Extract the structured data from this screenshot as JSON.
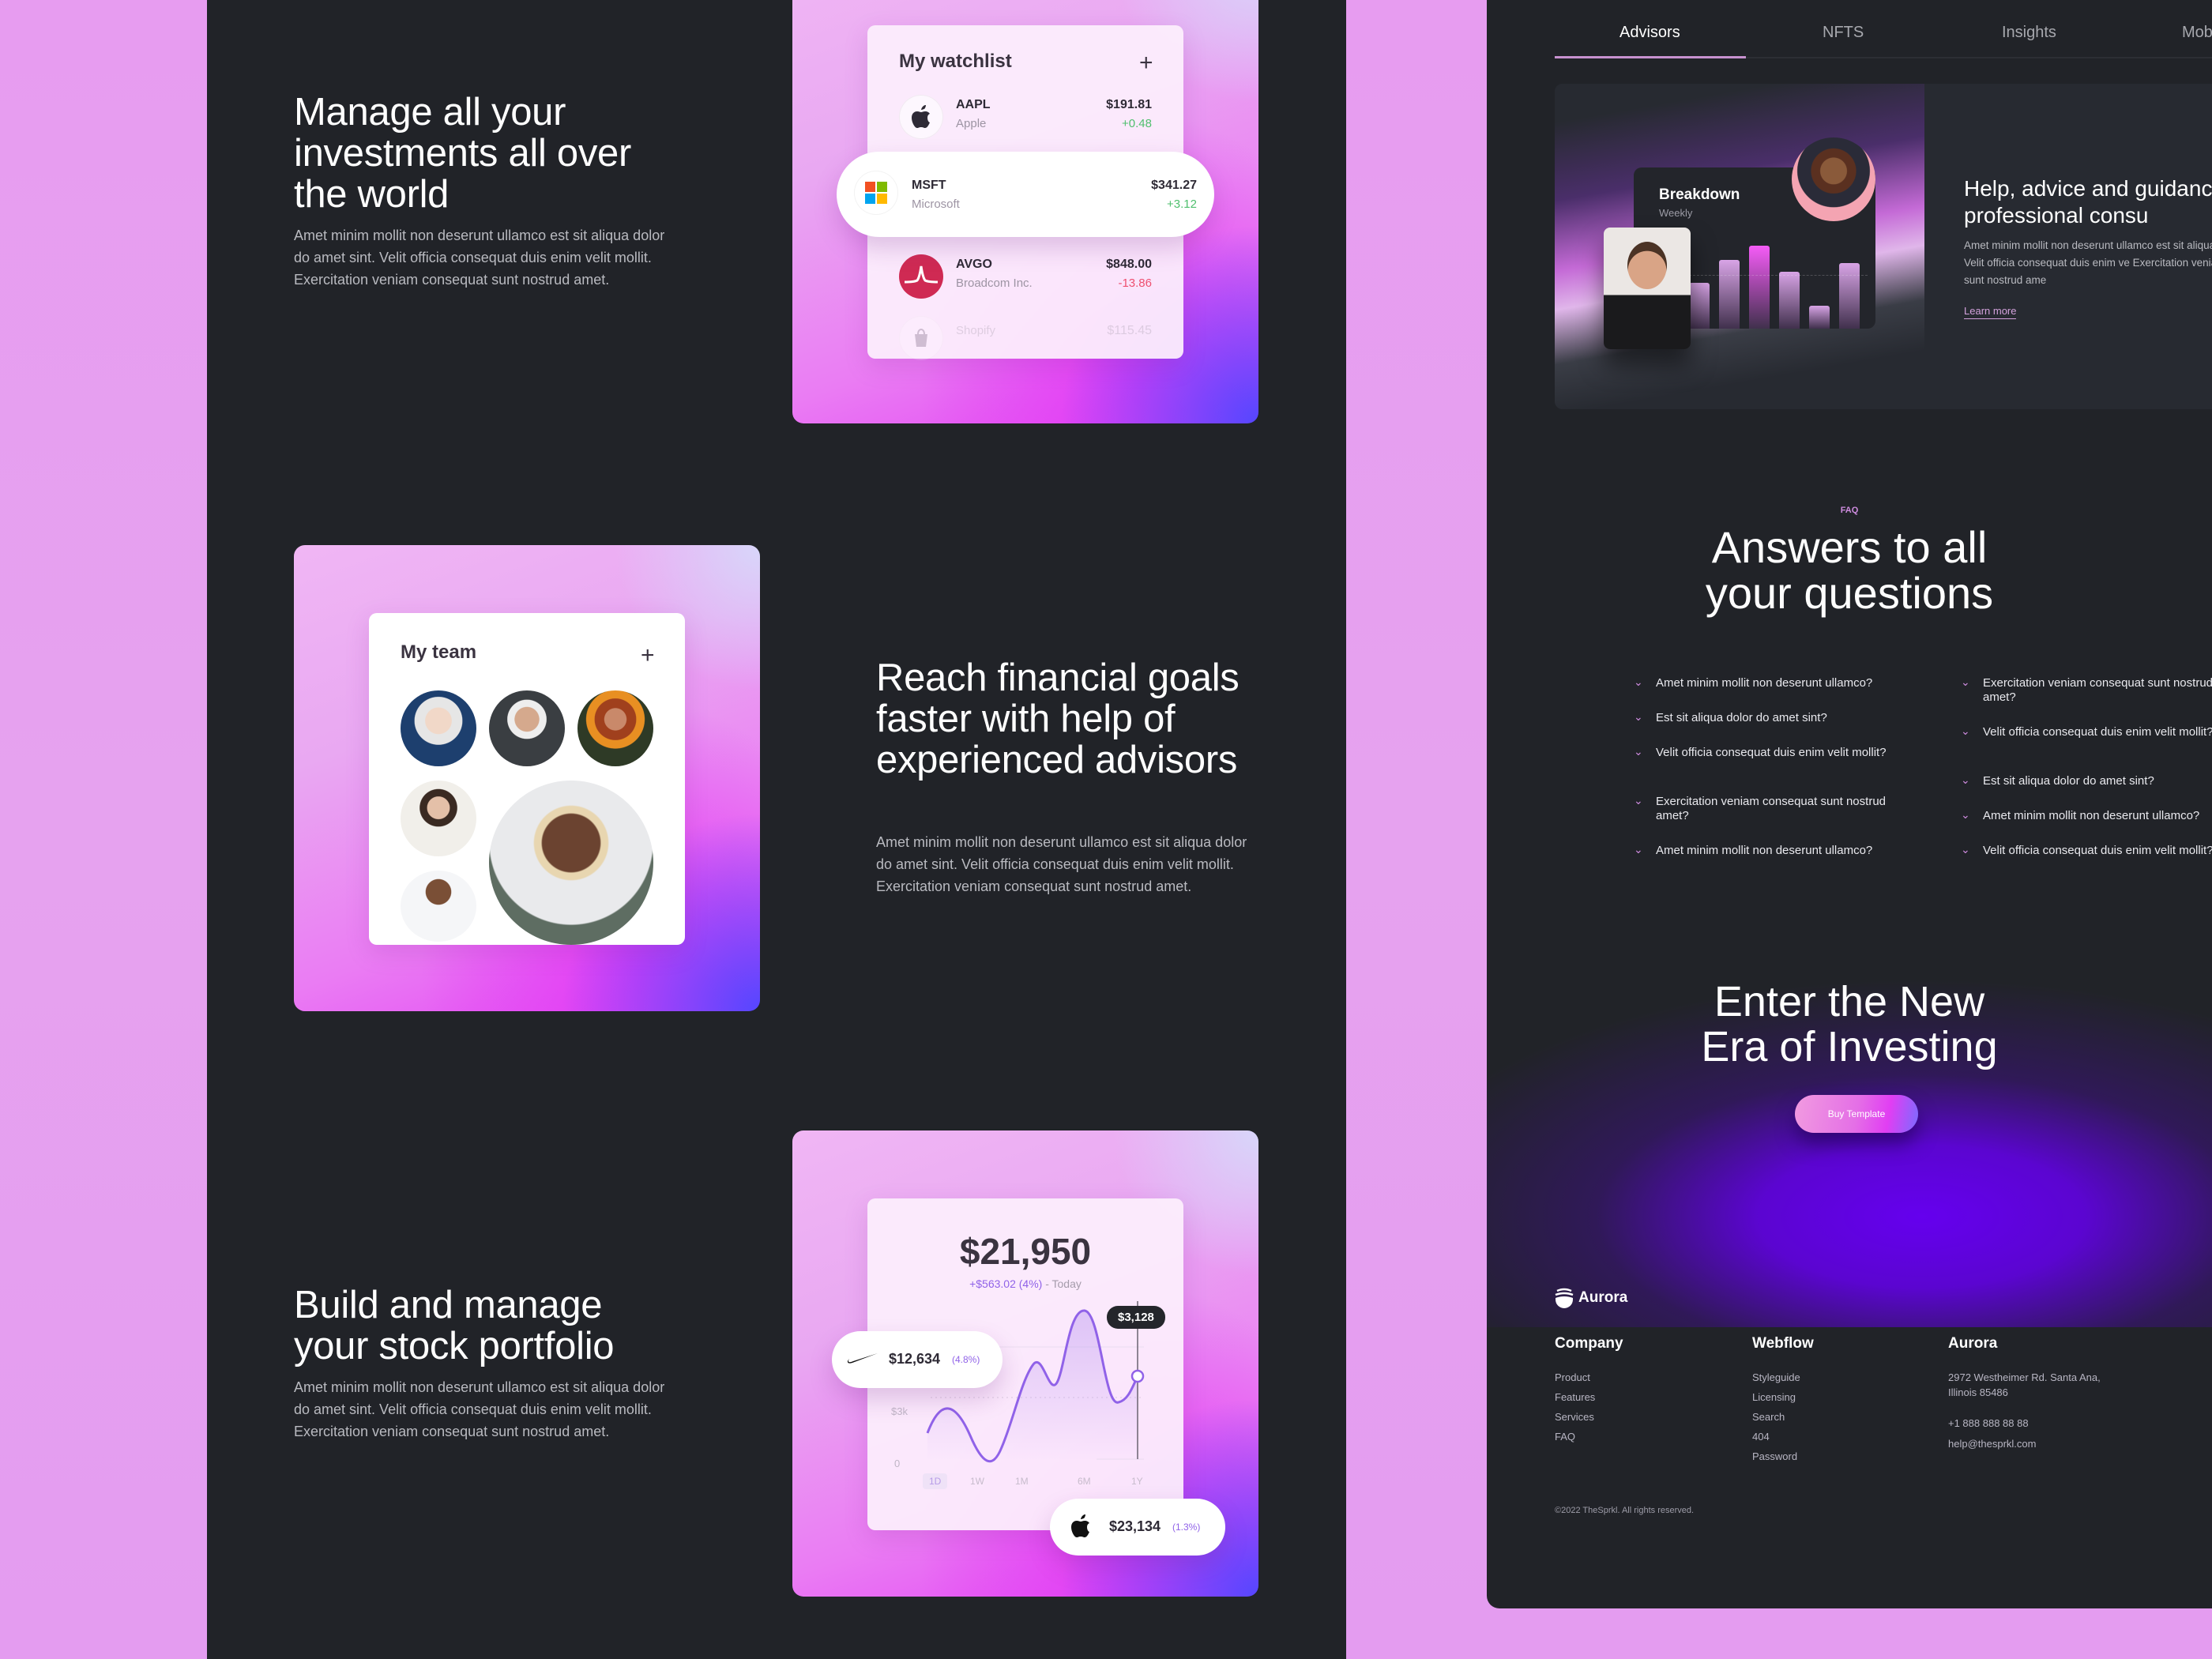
{
  "colors": {
    "dark_bg": "#212328",
    "page_bg": "#e79cf0",
    "accent_pink": "#cf8ce0",
    "positive": "#4fbf6e",
    "negative": "#ee5070",
    "chart_line": "#9062e8"
  },
  "left": {
    "section1": {
      "heading": "Manage all your investments all over the world",
      "body": "Amet minim mollit non deserunt ullamco est sit aliqua dolor do amet sint. Velit officia consequat duis enim velit mollit. Exercitation veniam consequat sunt nostrud amet."
    },
    "watchlist": {
      "title": "My watchlist",
      "add_icon": "plus-icon",
      "items": [
        {
          "ticker": "AAPL",
          "name": "Apple",
          "price": "$191.81",
          "change": "+0.48",
          "icon": "apple-logo-icon"
        },
        {
          "ticker": "MSFT",
          "name": "Microsoft",
          "price": "$341.27",
          "change": "+3.12",
          "icon": "microsoft-logo-icon"
        },
        {
          "ticker": "AVGO",
          "name": "Broadcom Inc.",
          "price": "$848.00",
          "change": "-13.86",
          "icon": "broadcom-logo-icon"
        },
        {
          "ticker": "",
          "name": "Shopify",
          "price": "$115.45",
          "change": "",
          "icon": "shopify-logo-icon"
        }
      ]
    },
    "section2": {
      "heading": "Reach financial goals faster with help of experienced advisors",
      "body": "Amet minim mollit non deserunt ullamco est sit aliqua dolor do amet sint. Velit officia consequat duis enim velit mollit. Exercitation veniam consequat sunt nostrud amet."
    },
    "team": {
      "title": "My team",
      "add_icon": "plus-icon",
      "members": 6
    },
    "section3": {
      "heading": "Build and manage your stock portfolio",
      "body": "Amet minim mollit non deserunt ullamco est sit aliqua dolor do amet sint. Velit officia consequat duis enim velit mollit. Exercitation veniam consequat sunt nostrud amet."
    },
    "portfolio": {
      "total": "$21,950",
      "change": "+$563.02 (4%)",
      "change_suffix": "- Today",
      "tooltip": "$3,128",
      "y_labels": [
        "$3k",
        "0"
      ],
      "ranges": [
        "1D",
        "1W",
        "1M",
        "6M",
        "1Y"
      ],
      "active_range": "1D",
      "nike": {
        "value": "$12,634",
        "pct": "(4.8%)"
      },
      "apple": {
        "value": "$23,134",
        "pct": "(1.3%)"
      }
    }
  },
  "right": {
    "tabs": [
      "Advisors",
      "NFTS",
      "Insights",
      "Mob"
    ],
    "active_tab": "Advisors",
    "advisor": {
      "breakdown_title": "Breakdown",
      "breakdown_sub": "Weekly",
      "bars": [
        0.47,
        0.7,
        0.85,
        0.58,
        0.23,
        0.67
      ],
      "heading": "Help, advice and guidance from professional consu",
      "body": "Amet minim mollit non deserunt ullamco est sit aliqua do amet sint. Velit officia consequat duis enim ve Exercitation veniam consequat sunt nostrud ame",
      "link": "Learn more"
    },
    "faq": {
      "eyebrow": "FAQ",
      "heading": "Answers to all your questions",
      "left": [
        "Amet minim mollit non deserunt ullamco?",
        "Est sit aliqua dolor do amet sint?",
        "Velit officia consequat duis enim velit mollit?",
        "Exercitation veniam consequat sunt nostrud amet?",
        "Amet minim mollit non deserunt ullamco?"
      ],
      "right": [
        "Exercitation veniam consequat sunt nostrud amet?",
        "Velit officia consequat duis enim velit mollit?",
        "Est sit aliqua dolor do amet sint?",
        "Amet minim mollit non deserunt ullamco?",
        "Velit officia consequat duis enim velit mollit?"
      ]
    },
    "cta": {
      "heading": "Enter the New Era of Investing",
      "button": "Buy Template"
    },
    "footer": {
      "brand": "Aurora",
      "columns": [
        {
          "title": "Company",
          "links": [
            "Product",
            "Features",
            "Services",
            "FAQ"
          ]
        },
        {
          "title": "Webflow",
          "links": [
            "Styleguide",
            "Licensing",
            "Search",
            "404",
            "Password"
          ]
        },
        {
          "title": "Aurora",
          "links": [
            "2972 Westheimer Rd. Santa Ana, Illinois 85486",
            "+1 888 888 88 88",
            "help@thesprkl.com"
          ]
        }
      ],
      "copyright": "©2022 TheSprkl. All rights reserved."
    }
  }
}
